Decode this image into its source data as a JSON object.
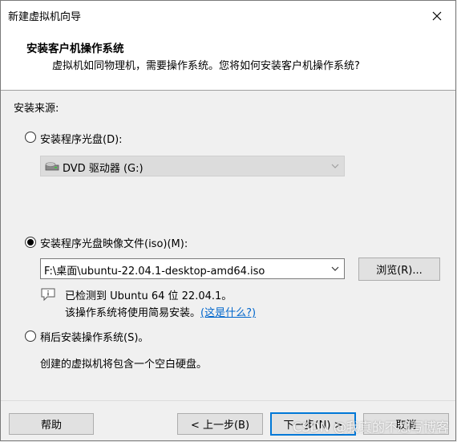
{
  "window": {
    "title": "新建虚拟机向导"
  },
  "header": {
    "title": "安装客户机操作系统",
    "subtitle": "虚拟机如同物理机，需要操作系统。您将如何安装客户机操作系统?"
  },
  "source": {
    "label": "安装来源:",
    "option_disc": {
      "label": "安装程序光盘(D):",
      "selected": false
    },
    "disc_drive": {
      "value": "DVD 驱动器 (G:)",
      "enabled": false
    },
    "option_iso": {
      "label": "安装程序光盘映像文件(iso)(M):",
      "selected": true
    },
    "iso_path": {
      "value": "F:\\桌面\\ubuntu-22.04.1-desktop-amd64.iso"
    },
    "browse_label": "浏览(R)...",
    "detected_text": "已检测到 Ubuntu 64 位 22.04.1。",
    "easy_install_text": "该操作系统将使用简易安装。",
    "what_is_this_link": "(这是什么?)",
    "option_later": {
      "label": "稍后安装操作系统(S)。",
      "selected": false
    },
    "later_desc": "创建的虚拟机将包含一个空白硬盘。"
  },
  "footer": {
    "help": "帮助",
    "back": "< 上一步(B)",
    "next": "下一步(N) >",
    "cancel": "取消"
  },
  "watermark": "CSDN @我真的不想写博客",
  "colors": {
    "accent": "#0078d7",
    "link": "#0066cc"
  }
}
